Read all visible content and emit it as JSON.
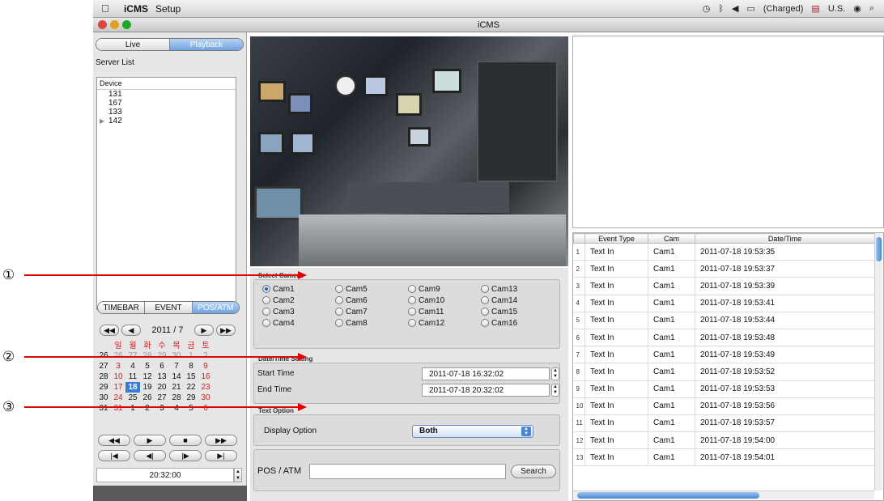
{
  "menubar": {
    "app": "iCMS",
    "setup": "Setup",
    "status": "(Charged)",
    "locale": "U.S."
  },
  "window": {
    "title": "iCMS"
  },
  "mode_tabs": [
    "Live",
    "Playback"
  ],
  "server_list": {
    "title": "Server List",
    "header": "Device",
    "items": [
      "131",
      "167",
      "133",
      "142"
    ]
  },
  "search_tabs": [
    "TIMEBAR",
    "EVENT",
    "POS/ATM"
  ],
  "calendar": {
    "month_label": "2011 / 7",
    "weekdays": [
      "일",
      "월",
      "화",
      "수",
      "목",
      "금",
      "토"
    ],
    "rows": [
      [
        "26",
        "26",
        "27",
        "28",
        "29",
        "30",
        "1",
        "2"
      ],
      [
        "27",
        "3",
        "4",
        "5",
        "6",
        "7",
        "8",
        "9"
      ],
      [
        "28",
        "10",
        "11",
        "12",
        "13",
        "14",
        "15",
        "16"
      ],
      [
        "29",
        "17",
        "18",
        "19",
        "20",
        "21",
        "22",
        "23"
      ],
      [
        "30",
        "24",
        "25",
        "26",
        "27",
        "28",
        "29",
        "30"
      ],
      [
        "31",
        "31",
        "1",
        "2",
        "3",
        "4",
        "5",
        "6"
      ]
    ],
    "selected": "18"
  },
  "time_display": "20:32:00",
  "select_camera": {
    "title": "Select Camera",
    "cams": [
      "Cam1",
      "Cam5",
      "Cam9",
      "Cam13",
      "Cam2",
      "Cam6",
      "Cam10",
      "Cam14",
      "Cam3",
      "Cam7",
      "Cam11",
      "Cam15",
      "Cam4",
      "Cam8",
      "Cam12",
      "Cam16"
    ],
    "selected": "Cam1"
  },
  "datetime": {
    "title": "Date/Time Setting",
    "start_label": "Start Time",
    "start_value": "2011-07-18 16:32:02",
    "end_label": "End Time",
    "end_value": "2011-07-18 20:32:02"
  },
  "text_option": {
    "title": "Text Option",
    "display_label": "Display Option",
    "display_value": "Both"
  },
  "pos": {
    "label": "POS / ATM",
    "value": "",
    "search": "Search"
  },
  "events": {
    "columns": [
      "Event Type",
      "Cam",
      "Date/Time"
    ],
    "rows": [
      [
        "1",
        "Text In",
        "Cam1",
        "2011-07-18 19:53:35"
      ],
      [
        "2",
        "Text In",
        "Cam1",
        "2011-07-18 19:53:37"
      ],
      [
        "3",
        "Text In",
        "Cam1",
        "2011-07-18 19:53:39"
      ],
      [
        "4",
        "Text In",
        "Cam1",
        "2011-07-18 19:53:41"
      ],
      [
        "5",
        "Text In",
        "Cam1",
        "2011-07-18 19:53:44"
      ],
      [
        "6",
        "Text In",
        "Cam1",
        "2011-07-18 19:53:48"
      ],
      [
        "7",
        "Text In",
        "Cam1",
        "2011-07-18 19:53:49"
      ],
      [
        "8",
        "Text In",
        "Cam1",
        "2011-07-18 19:53:52"
      ],
      [
        "9",
        "Text In",
        "Cam1",
        "2011-07-18 19:53:53"
      ],
      [
        "10",
        "Text In",
        "Cam1",
        "2011-07-18 19:53:56"
      ],
      [
        "11",
        "Text In",
        "Cam1",
        "2011-07-18 19:53:57"
      ],
      [
        "12",
        "Text In",
        "Cam1",
        "2011-07-18 19:54:00"
      ],
      [
        "13",
        "Text In",
        "Cam1",
        "2011-07-18 19:54:01"
      ]
    ]
  },
  "annotations": [
    "①",
    "②",
    "③"
  ],
  "colors": {
    "arrow": "#e00000",
    "accent": "#6fa3e0"
  }
}
